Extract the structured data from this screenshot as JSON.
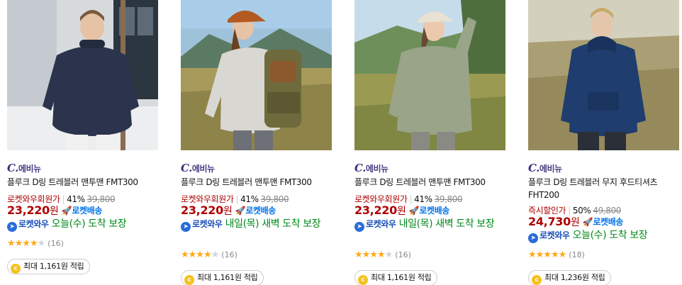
{
  "products": [
    {
      "brand_mark": "C.",
      "brand_name": "에비뉴",
      "title": "플루크 D링 트레블러 맨투맨 FMT300",
      "price_label": "로켓와우회원가",
      "discount": "41%",
      "original_price": "39,800",
      "sale_price": "23,220",
      "currency": "원",
      "rocket_label": "로켓배송",
      "wow_label": "로켓와우",
      "delivery_text": "오늘(수) 도착 보장",
      "rating": 3.5,
      "review_count": "(16)",
      "points_text": "최대 1,161원 적립",
      "image_icon": "model-navy-sweatshirt"
    },
    {
      "brand_mark": "C.",
      "brand_name": "에비뉴",
      "title": "플루크 D링 트레블러 맨투맨 FMT300",
      "price_label": "로켓와우회원가",
      "discount": "41%",
      "original_price": "39,800",
      "sale_price": "23,220",
      "currency": "원",
      "rocket_label": "로켓배송",
      "wow_label": "로켓와우",
      "delivery_text": "내일(목) 새벽 도착 보장",
      "rating": 3.5,
      "review_count": "(16)",
      "points_text": "최대 1,161원 적립",
      "image_icon": "model-gray-sweatshirt"
    },
    {
      "brand_mark": "C.",
      "brand_name": "에비뉴",
      "title": "플루크 D링 트레블러 맨투맨 FMT300",
      "price_label": "로켓와우회원가",
      "discount": "41%",
      "original_price": "39,800",
      "sale_price": "23,220",
      "currency": "원",
      "rocket_label": "로켓배송",
      "wow_label": "로켓와우",
      "delivery_text": "내일(목) 새벽 도착 보장",
      "rating": 3.5,
      "review_count": "(16)",
      "points_text": "최대 1,161원 적립",
      "image_icon": "model-sage-sweatshirt"
    },
    {
      "brand_mark": "C.",
      "brand_name": "에비뉴",
      "title": "플루크 D링 트레블러 무지 후드티셔츠 FHT200",
      "price_label": "즉시할인가",
      "discount": "50%",
      "original_price": "49,800",
      "sale_price": "24,730",
      "currency": "원",
      "rocket_label": "로켓배송",
      "wow_label": "로켓와우",
      "delivery_text": "오늘(수) 도착 보장",
      "rating": 4.5,
      "review_count": "(18)",
      "points_text": "최대 1,236원 적립",
      "image_icon": "model-navy-hoodie"
    }
  ],
  "colors": {
    "price_red": "#ae0000",
    "rocket_blue": "#0073e9",
    "delivery_green": "#00891a",
    "star_orange": "#ffa91a",
    "brand_purple": "#4a3a82"
  }
}
